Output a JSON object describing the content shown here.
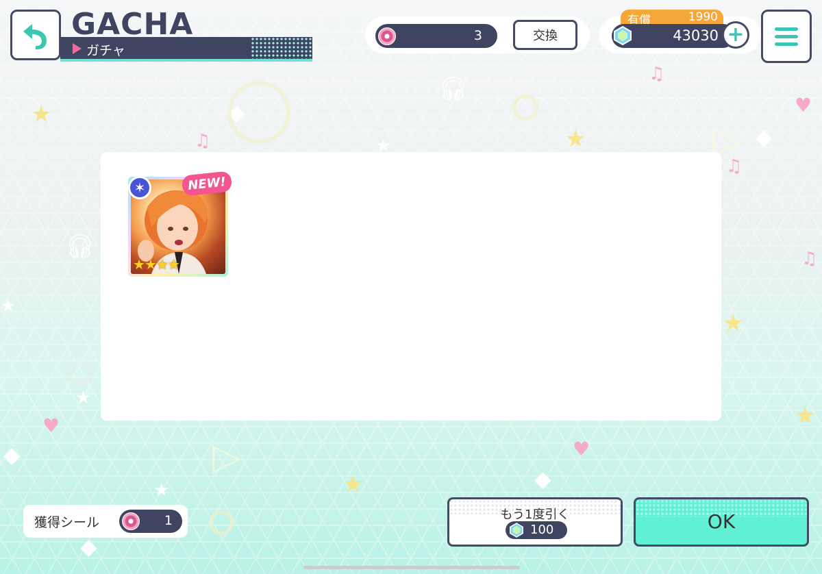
{
  "header": {
    "title": "GACHA",
    "subtitle": "ガチャ"
  },
  "currency": {
    "sticker_count": "3",
    "exchange_label": "交換",
    "paid_label": "有償",
    "paid_value": "1990",
    "gem_total": "43030",
    "plus_label": "+"
  },
  "result": {
    "new_badge": "NEW!",
    "rarity_stars": 4
  },
  "footer": {
    "stickers_label": "獲得シール",
    "stickers_value": "1",
    "again_label": "もう1度引く",
    "again_cost": "100",
    "ok_label": "OK"
  },
  "icons": {
    "back": "back-arrow-icon",
    "menu": "hamburger-menu-icon",
    "gem": "gem-icon",
    "sticker": "disc-sticker-icon",
    "attribute": "star-attribute-icon"
  },
  "colors": {
    "navy": "#3f4561",
    "teal": "#3cc6b4",
    "ok_green": "#5ff0d6",
    "pink": "#f2558f",
    "gold": "#f6a739"
  }
}
